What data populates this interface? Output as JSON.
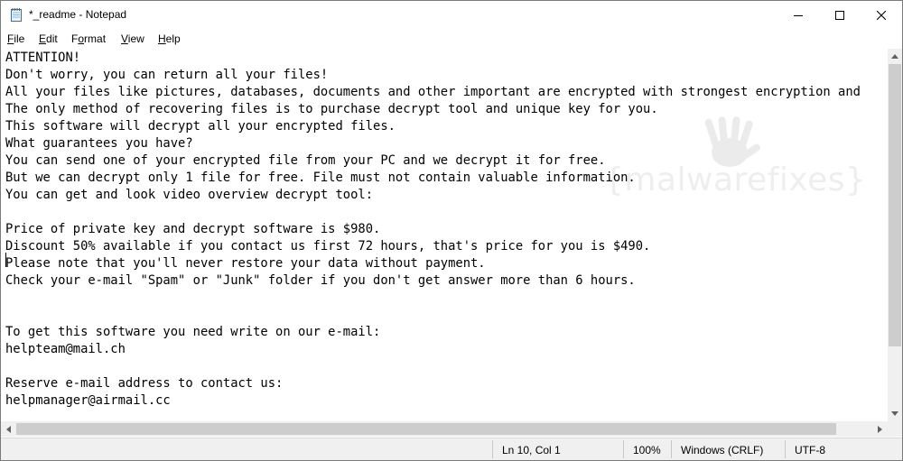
{
  "window": {
    "title": "*_readme - Notepad"
  },
  "menu": [
    {
      "label": "File",
      "key": "F",
      "rest": "ile"
    },
    {
      "label": "Edit",
      "key": "E",
      "rest": "dit"
    },
    {
      "label": "Format",
      "key": "o",
      "pre": "F",
      "rest": "rmat"
    },
    {
      "label": "View",
      "key": "V",
      "rest": "iew"
    },
    {
      "label": "Help",
      "key": "H",
      "rest": "elp"
    }
  ],
  "editor": {
    "lines": [
      "ATTENTION!",
      "Don't worry, you can return all your files!",
      "All your files like pictures, databases, documents and other important are encrypted with strongest encryption and",
      "The only method of recovering files is to purchase decrypt tool and unique key for you.",
      "This software will decrypt all your encrypted files.",
      "What guarantees you have?",
      "You can send one of your encrypted file from your PC and we decrypt it for free.",
      "But we can decrypt only 1 file for free. File must not contain valuable information.",
      "You can get and look video overview decrypt tool:",
      "",
      "Price of private key and decrypt software is $980.",
      "Discount 50% available if you contact us first 72 hours, that's price for you is $490.",
      "Please note that you'll never restore your data without payment.",
      "Check your e-mail \"Spam\" or \"Junk\" folder if you don't get answer more than 6 hours.",
      "",
      "",
      "To get this software you need write on our e-mail:",
      "helpteam@mail.ch",
      "",
      "Reserve e-mail address to contact us:",
      "helpmanager@airmail.cc"
    ]
  },
  "watermark": {
    "text": "{malwarefixes}"
  },
  "status": {
    "position": "Ln 10, Col 1",
    "zoom": "100%",
    "line_ending": "Windows (CRLF)",
    "encoding": "UTF-8"
  },
  "icons": [
    "notepad-app-icon",
    "minimize-icon",
    "maximize-icon",
    "close-icon",
    "scroll-up-arrow-icon",
    "scroll-down-arrow-icon",
    "scroll-left-arrow-icon",
    "scroll-right-arrow-icon"
  ]
}
